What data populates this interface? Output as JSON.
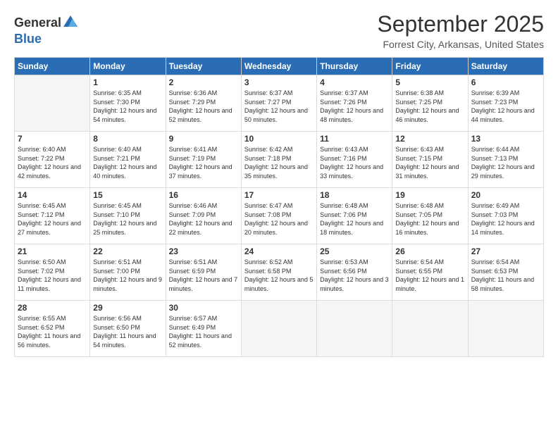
{
  "logo": {
    "general": "General",
    "blue": "Blue"
  },
  "header": {
    "month": "September 2025",
    "location": "Forrest City, Arkansas, United States"
  },
  "weekdays": [
    "Sunday",
    "Monday",
    "Tuesday",
    "Wednesday",
    "Thursday",
    "Friday",
    "Saturday"
  ],
  "weeks": [
    [
      {
        "day": "",
        "sunrise": "",
        "sunset": "",
        "daylight": ""
      },
      {
        "day": "1",
        "sunrise": "Sunrise: 6:35 AM",
        "sunset": "Sunset: 7:30 PM",
        "daylight": "Daylight: 12 hours and 54 minutes."
      },
      {
        "day": "2",
        "sunrise": "Sunrise: 6:36 AM",
        "sunset": "Sunset: 7:29 PM",
        "daylight": "Daylight: 12 hours and 52 minutes."
      },
      {
        "day": "3",
        "sunrise": "Sunrise: 6:37 AM",
        "sunset": "Sunset: 7:27 PM",
        "daylight": "Daylight: 12 hours and 50 minutes."
      },
      {
        "day": "4",
        "sunrise": "Sunrise: 6:37 AM",
        "sunset": "Sunset: 7:26 PM",
        "daylight": "Daylight: 12 hours and 48 minutes."
      },
      {
        "day": "5",
        "sunrise": "Sunrise: 6:38 AM",
        "sunset": "Sunset: 7:25 PM",
        "daylight": "Daylight: 12 hours and 46 minutes."
      },
      {
        "day": "6",
        "sunrise": "Sunrise: 6:39 AM",
        "sunset": "Sunset: 7:23 PM",
        "daylight": "Daylight: 12 hours and 44 minutes."
      }
    ],
    [
      {
        "day": "7",
        "sunrise": "Sunrise: 6:40 AM",
        "sunset": "Sunset: 7:22 PM",
        "daylight": "Daylight: 12 hours and 42 minutes."
      },
      {
        "day": "8",
        "sunrise": "Sunrise: 6:40 AM",
        "sunset": "Sunset: 7:21 PM",
        "daylight": "Daylight: 12 hours and 40 minutes."
      },
      {
        "day": "9",
        "sunrise": "Sunrise: 6:41 AM",
        "sunset": "Sunset: 7:19 PM",
        "daylight": "Daylight: 12 hours and 37 minutes."
      },
      {
        "day": "10",
        "sunrise": "Sunrise: 6:42 AM",
        "sunset": "Sunset: 7:18 PM",
        "daylight": "Daylight: 12 hours and 35 minutes."
      },
      {
        "day": "11",
        "sunrise": "Sunrise: 6:43 AM",
        "sunset": "Sunset: 7:16 PM",
        "daylight": "Daylight: 12 hours and 33 minutes."
      },
      {
        "day": "12",
        "sunrise": "Sunrise: 6:43 AM",
        "sunset": "Sunset: 7:15 PM",
        "daylight": "Daylight: 12 hours and 31 minutes."
      },
      {
        "day": "13",
        "sunrise": "Sunrise: 6:44 AM",
        "sunset": "Sunset: 7:13 PM",
        "daylight": "Daylight: 12 hours and 29 minutes."
      }
    ],
    [
      {
        "day": "14",
        "sunrise": "Sunrise: 6:45 AM",
        "sunset": "Sunset: 7:12 PM",
        "daylight": "Daylight: 12 hours and 27 minutes."
      },
      {
        "day": "15",
        "sunrise": "Sunrise: 6:45 AM",
        "sunset": "Sunset: 7:10 PM",
        "daylight": "Daylight: 12 hours and 25 minutes."
      },
      {
        "day": "16",
        "sunrise": "Sunrise: 6:46 AM",
        "sunset": "Sunset: 7:09 PM",
        "daylight": "Daylight: 12 hours and 22 minutes."
      },
      {
        "day": "17",
        "sunrise": "Sunrise: 6:47 AM",
        "sunset": "Sunset: 7:08 PM",
        "daylight": "Daylight: 12 hours and 20 minutes."
      },
      {
        "day": "18",
        "sunrise": "Sunrise: 6:48 AM",
        "sunset": "Sunset: 7:06 PM",
        "daylight": "Daylight: 12 hours and 18 minutes."
      },
      {
        "day": "19",
        "sunrise": "Sunrise: 6:48 AM",
        "sunset": "Sunset: 7:05 PM",
        "daylight": "Daylight: 12 hours and 16 minutes."
      },
      {
        "day": "20",
        "sunrise": "Sunrise: 6:49 AM",
        "sunset": "Sunset: 7:03 PM",
        "daylight": "Daylight: 12 hours and 14 minutes."
      }
    ],
    [
      {
        "day": "21",
        "sunrise": "Sunrise: 6:50 AM",
        "sunset": "Sunset: 7:02 PM",
        "daylight": "Daylight: 12 hours and 11 minutes."
      },
      {
        "day": "22",
        "sunrise": "Sunrise: 6:51 AM",
        "sunset": "Sunset: 7:00 PM",
        "daylight": "Daylight: 12 hours and 9 minutes."
      },
      {
        "day": "23",
        "sunrise": "Sunrise: 6:51 AM",
        "sunset": "Sunset: 6:59 PM",
        "daylight": "Daylight: 12 hours and 7 minutes."
      },
      {
        "day": "24",
        "sunrise": "Sunrise: 6:52 AM",
        "sunset": "Sunset: 6:58 PM",
        "daylight": "Daylight: 12 hours and 5 minutes."
      },
      {
        "day": "25",
        "sunrise": "Sunrise: 6:53 AM",
        "sunset": "Sunset: 6:56 PM",
        "daylight": "Daylight: 12 hours and 3 minutes."
      },
      {
        "day": "26",
        "sunrise": "Sunrise: 6:54 AM",
        "sunset": "Sunset: 6:55 PM",
        "daylight": "Daylight: 12 hours and 1 minute."
      },
      {
        "day": "27",
        "sunrise": "Sunrise: 6:54 AM",
        "sunset": "Sunset: 6:53 PM",
        "daylight": "Daylight: 11 hours and 58 minutes."
      }
    ],
    [
      {
        "day": "28",
        "sunrise": "Sunrise: 6:55 AM",
        "sunset": "Sunset: 6:52 PM",
        "daylight": "Daylight: 11 hours and 56 minutes."
      },
      {
        "day": "29",
        "sunrise": "Sunrise: 6:56 AM",
        "sunset": "Sunset: 6:50 PM",
        "daylight": "Daylight: 11 hours and 54 minutes."
      },
      {
        "day": "30",
        "sunrise": "Sunrise: 6:57 AM",
        "sunset": "Sunset: 6:49 PM",
        "daylight": "Daylight: 11 hours and 52 minutes."
      },
      {
        "day": "",
        "sunrise": "",
        "sunset": "",
        "daylight": ""
      },
      {
        "day": "",
        "sunrise": "",
        "sunset": "",
        "daylight": ""
      },
      {
        "day": "",
        "sunrise": "",
        "sunset": "",
        "daylight": ""
      },
      {
        "day": "",
        "sunrise": "",
        "sunset": "",
        "daylight": ""
      }
    ]
  ]
}
